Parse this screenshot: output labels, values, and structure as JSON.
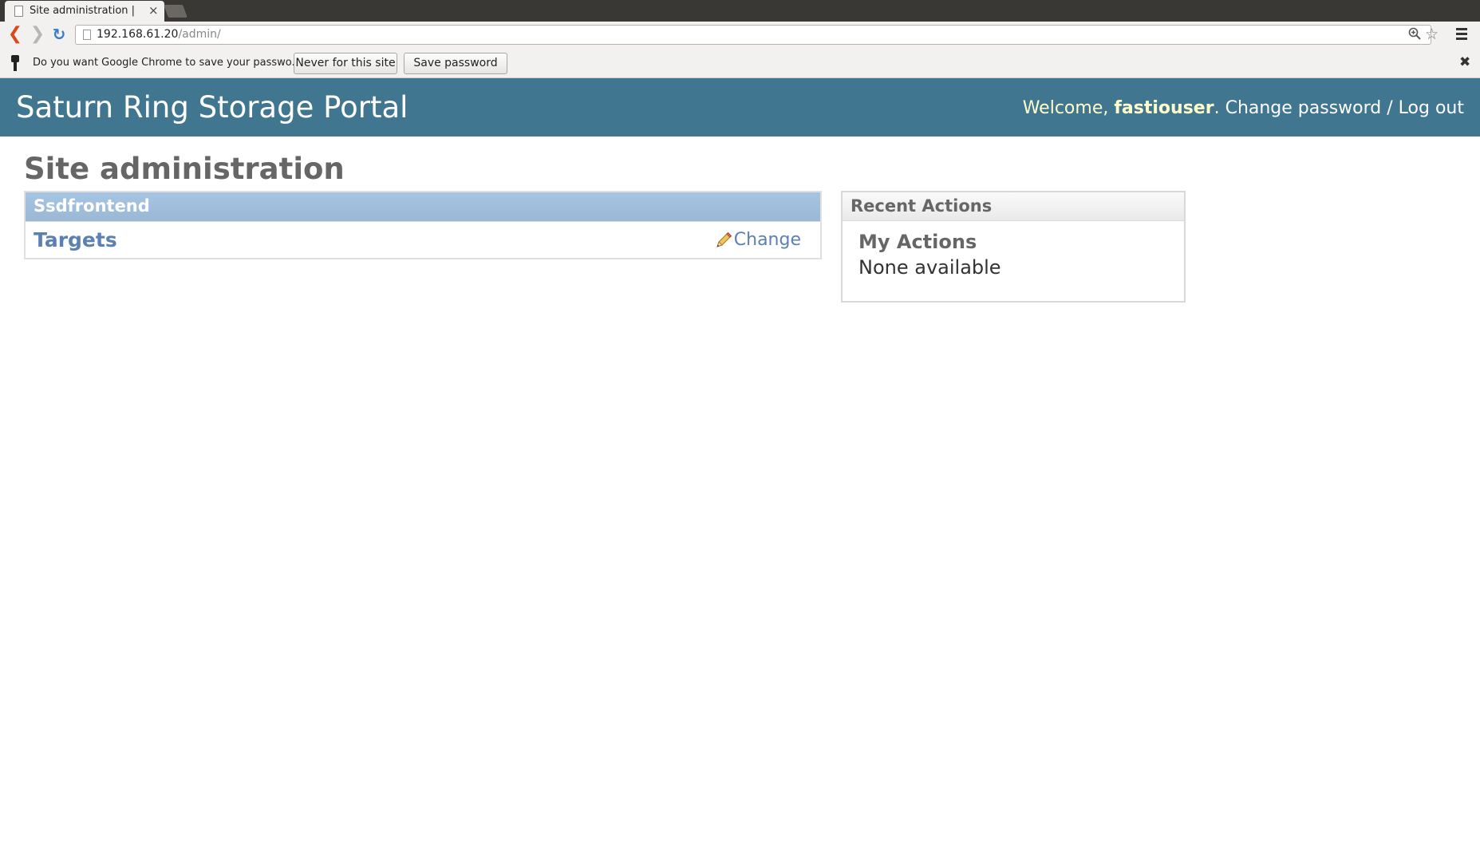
{
  "browser": {
    "tab_title": "Site administration |",
    "tab_close": "×",
    "url_host": "192.168.61.20",
    "url_path": "/admin/",
    "infobar": {
      "prompt": "Do you want Google Chrome to save your passwo...",
      "never_label": "Never for this site",
      "save_label": "Save password",
      "close": "✖"
    }
  },
  "header": {
    "branding": "Saturn Ring Storage Portal",
    "welcome": "Welcome,",
    "username": "fastiouser",
    "period": ".",
    "change_password": "Change password",
    "separator": "/",
    "log_out": "Log out"
  },
  "main": {
    "title": "Site administration",
    "apps": [
      {
        "caption": "Ssdfrontend",
        "models": [
          {
            "name": "Targets",
            "change_label": "Change"
          }
        ]
      }
    ]
  },
  "sidebar": {
    "recent_caption": "Recent Actions",
    "my_actions": "My Actions",
    "empty_text": "None available"
  },
  "colors": {
    "header_bg": "#417690",
    "user_tools_text": "#ffffcc",
    "link": "#5b80b2",
    "module_caption_bg": "#9ab8d6"
  }
}
